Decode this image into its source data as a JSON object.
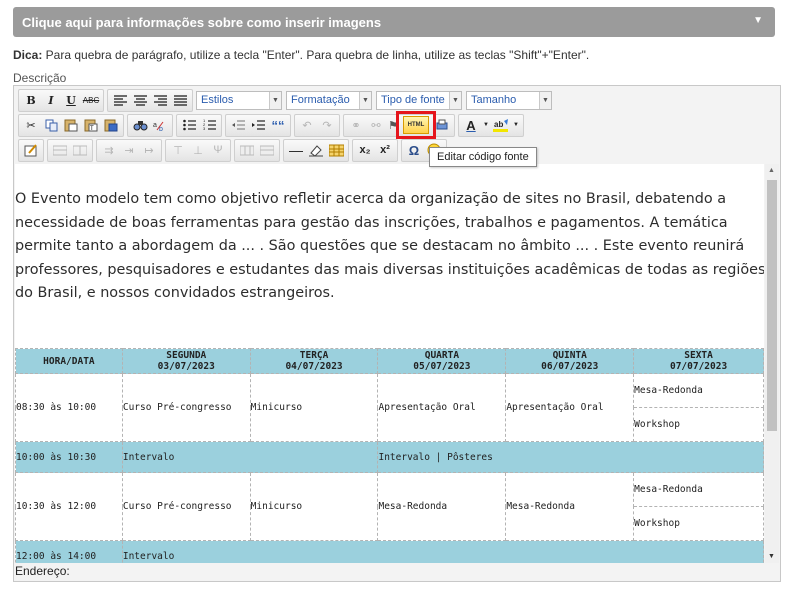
{
  "accordion": {
    "title": "Clique aqui para informações sobre como inserir imagens",
    "chevron": "chevron-down-icon"
  },
  "hint": {
    "label": "Dica:",
    "text": " Para quebra de parágrafo, utilize a tecla \"Enter\". Para quebra de linha, utilize as teclas \"Shift\"+\"Enter\"."
  },
  "field_label": "Descrição",
  "toolbar": {
    "bold": "B",
    "italic": "I",
    "underline": "U",
    "strike": "ABC",
    "styles": "Estilos",
    "format": "Formatação",
    "font": "Tipo de fonte",
    "size": "Tamanho",
    "source_html": "HTML",
    "quote": "““",
    "omega": "Ω",
    "subscript": "x₂",
    "superscript": "x²"
  },
  "tooltip": "Editar código fonte",
  "content": {
    "paragraph": "O Evento modelo tem como objetivo refletir acerca da organização de sites no Brasil, debatendo a necessidade de boas ferramentas para gestão das inscrições, trabalhos e pagamentos. A temática permite tanto a abordagem da ... . São questões que se destacam no âmbito ... . Este evento reunirá professores, pesquisadores e estudantes das mais diversas instituições acadêmicas de todas as regiões do Brasil, e nossos convidados estrangeiros."
  },
  "schedule": {
    "headers": [
      {
        "l1": "HORA/DATA",
        "l2": ""
      },
      {
        "l1": "SEGUNDA",
        "l2": "03/07/2023"
      },
      {
        "l1": "TERÇA",
        "l2": "04/07/2023"
      },
      {
        "l1": "QUARTA",
        "l2": "05/07/2023"
      },
      {
        "l1": "QUINTA",
        "l2": "06/07/2023"
      },
      {
        "l1": "SEXTA",
        "l2": "07/07/2023"
      }
    ],
    "row1": {
      "time": "08:30 às 10:00",
      "mon": "Curso Pré-congresso",
      "tue": "Minicurso",
      "wed": "Apresentação Oral",
      "thu": "Apresentação Oral",
      "fri_a": "Mesa-Redonda",
      "fri_b": "Workshop"
    },
    "row2": {
      "time": "10:00 às 10:30",
      "mon": "Intervalo",
      "wed": "Intervalo | Pôsteres"
    },
    "row3": {
      "time": "10:30 às 12:00",
      "mon": "Curso Pré-congresso",
      "tue": "Minicurso",
      "wed": "Mesa-Redonda",
      "thu": "Mesa-Redonda",
      "fri_a": "Mesa-Redonda",
      "fri_b": "Workshop"
    },
    "row4": {
      "time": "12:00 às 14:00",
      "mon": "Intervalo"
    }
  },
  "status_path": "Endereço:",
  "colors": {
    "accordion": "#9b9b9b",
    "table_header": "#9bd0dd",
    "highlight": "#e5141b"
  }
}
